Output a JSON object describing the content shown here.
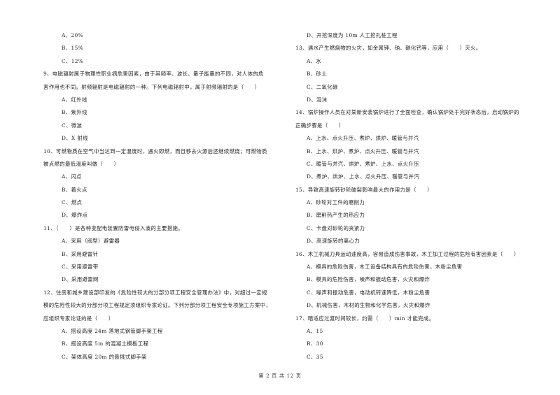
{
  "document": {
    "footer": "第 2 页 共 12 页",
    "left_column": [
      {
        "type": "option",
        "text": "A、20%"
      },
      {
        "type": "option",
        "text": "B、15%"
      },
      {
        "type": "option",
        "text": "C、12%"
      },
      {
        "type": "question",
        "text": "9、电磁辐射属于物理性职业病危害因素，由于其频率、波长、量子能量的不同，对人体的危"
      },
      {
        "type": "question",
        "text": "害作用也不同。射频辐射是电磁辐射的一种。下列电磁辐射中，属于射频辐射的是（　　）"
      },
      {
        "type": "option",
        "text": "A、红外线"
      },
      {
        "type": "option",
        "text": "B、紫外线"
      },
      {
        "type": "option",
        "text": "C、微波"
      },
      {
        "type": "option",
        "text": "D、X 射线"
      },
      {
        "type": "question",
        "text": "10、可燃物质在空气中当达到一定温度时，遇火即燃，而且移去火源后还继续燃烧；可燃物质"
      },
      {
        "type": "question",
        "text": "被点燃的最低温度叫做（　　）"
      },
      {
        "type": "option",
        "text": "A、闪点"
      },
      {
        "type": "option",
        "text": "B、着火点"
      },
      {
        "type": "option",
        "text": "C、燃点"
      },
      {
        "type": "option",
        "text": "D、爆炸点"
      },
      {
        "type": "question",
        "text": "11、（　　）是各种变配电装置防雷电侵入波的主要措施。"
      },
      {
        "type": "option",
        "text": "A、采用（阀型）避雷器"
      },
      {
        "type": "option",
        "text": "B、采用避雷针"
      },
      {
        "type": "option",
        "text": "C、采用避雷带"
      },
      {
        "type": "option",
        "text": "D、采用避雷网"
      },
      {
        "type": "question",
        "text": "12、住房和城乡建设部印发的《危险性较大的分部分项工程安全管理办法》中，对超过一定规"
      },
      {
        "type": "question",
        "text": "模的危险性较大的分部分项工程规定须组织专家论证。下列分部分项工程安全专项施工方案中，"
      },
      {
        "type": "question",
        "text": "应组织专家论证的是（　　）"
      },
      {
        "type": "option",
        "text": "A、搭设高度 24m 落地式钢管脚手架工程"
      },
      {
        "type": "option",
        "text": "B、搭设高度 5m 的混凝土模板工程"
      },
      {
        "type": "option",
        "text": "C、架体高度 20m 的悬挑式脚手架"
      }
    ],
    "right_column": [
      {
        "type": "option",
        "text": "D、开挖深度为 10m 人工挖孔桩工程"
      },
      {
        "type": "question",
        "text": "13、遇水产生燃烧物的火灾，如金属钾、钠、碳化钙等，应用（　　）灭火。"
      },
      {
        "type": "option",
        "text": "A、水"
      },
      {
        "type": "option",
        "text": "B、砂土"
      },
      {
        "type": "option",
        "text": "C、二氧化碳"
      },
      {
        "type": "option",
        "text": "D、泡沫"
      },
      {
        "type": "question",
        "text": "14、锅炉操作人员在对某新安装锅炉进行了全面检查，确认锅炉处于完好状态后，启动锅炉的"
      },
      {
        "type": "question",
        "text": "正确步骤是（　　）"
      },
      {
        "type": "option",
        "text": "A、上水、点火升压、煮炉、烘炉、暖管与并汽"
      },
      {
        "type": "option",
        "text": "B、上水、烘炉、煮炉、点火升压、暖管与并汽"
      },
      {
        "type": "option",
        "text": "C、暖管与并汽、烘炉、煮炉、上水、点火升压"
      },
      {
        "type": "option",
        "text": "D、煮炉、烘炉、上水、点火升压、暖管与并汽"
      },
      {
        "type": "question",
        "text": "15、导致高速旋转砂轮破裂影响最大的作用力是（　　）"
      },
      {
        "type": "option",
        "text": "A、砂轮对工件的磨削力"
      },
      {
        "type": "option",
        "text": "B、磨削热产生的热应力"
      },
      {
        "type": "option",
        "text": "C、卡盘对砂轮的夹紧力"
      },
      {
        "type": "option",
        "text": "D、高速旋转的离心力"
      },
      {
        "type": "question",
        "text": "16、木工机械刀具运动速度高，容易造成伤害事故，木工加工过程的危险有害因素是（　　）"
      },
      {
        "type": "option",
        "text": "A、模具的危险伤害，木工设备结构具有的危险伤害，木粉尘危害"
      },
      {
        "type": "option",
        "text": "B、模具的危险伤害，噪声和振动危害，火灾和爆炸"
      },
      {
        "type": "option",
        "text": "C、噪声和振动危害，电动机转速降低，木粉尘危害"
      },
      {
        "type": "option",
        "text": "D、机械伤害，木材的生物和化学危害，火灾和爆炸"
      },
      {
        "type": "question",
        "text": "17、暗适应过渡时间较长，约需（　　）min 才能完成。"
      },
      {
        "type": "option",
        "text": "A、15"
      },
      {
        "type": "option",
        "text": "B、30"
      },
      {
        "type": "option",
        "text": "C、35"
      }
    ]
  }
}
